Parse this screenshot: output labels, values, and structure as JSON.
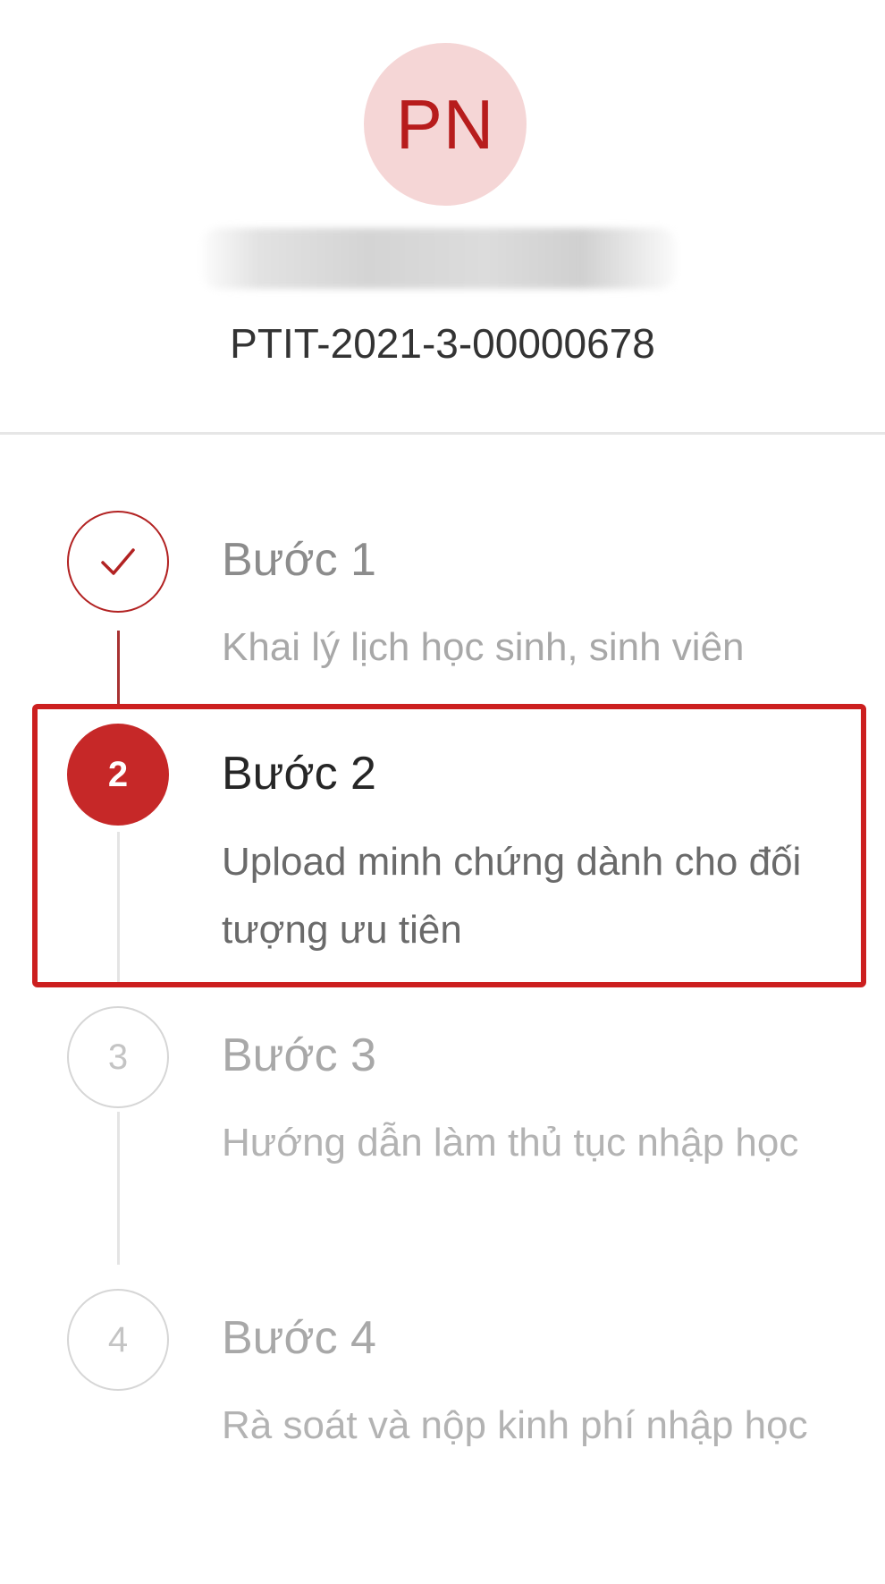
{
  "profile": {
    "initials": "PN",
    "student_id": "PTIT-2021-3-00000678"
  },
  "steps": [
    {
      "number": "1",
      "title": "Bước 1",
      "description": "Khai lý lịch học sinh, sinh viên",
      "status": "done"
    },
    {
      "number": "2",
      "title": "Bước 2",
      "description": "Upload minh chứng dành cho đối tượng ưu tiên",
      "status": "active"
    },
    {
      "number": "3",
      "title": "Bước 3",
      "description": "Hướng dẫn làm thủ tục nhập học",
      "status": "todo"
    },
    {
      "number": "4",
      "title": "Bước 4",
      "description": "Rà soát và nộp kinh phí nhập học",
      "status": "todo"
    }
  ],
  "colors": {
    "accent": "#c62828",
    "highlight_border": "#cc1f1f",
    "avatar_bg": "#f5d6d6"
  }
}
